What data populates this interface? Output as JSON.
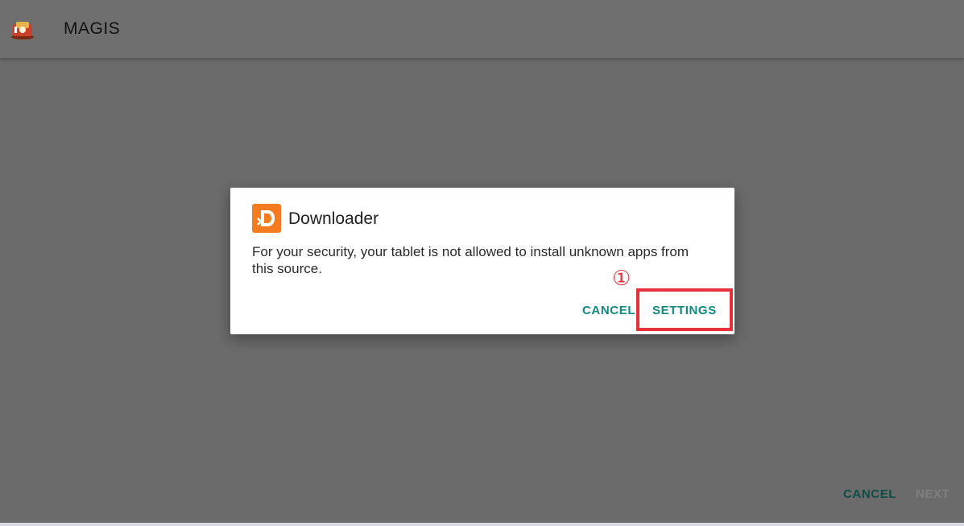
{
  "appbar": {
    "title": "MAGIS",
    "logo_icon": "magis-logo-icon"
  },
  "dialog": {
    "app_icon": "downloader-app-icon",
    "title": "Downloader",
    "message": "For your security, your tablet is not allowed to install unknown apps from this source.",
    "cancel_label": "CANCEL",
    "settings_label": "SETTINGS"
  },
  "annotation": {
    "step_marker": "①",
    "highlight_color": "#e8303a"
  },
  "footer": {
    "cancel_label": "CANCEL",
    "next_label": "NEXT"
  },
  "colors": {
    "accent": "#0f8a7e",
    "brand_orange": "#f47b20",
    "overlay": "#6b6b6b"
  }
}
